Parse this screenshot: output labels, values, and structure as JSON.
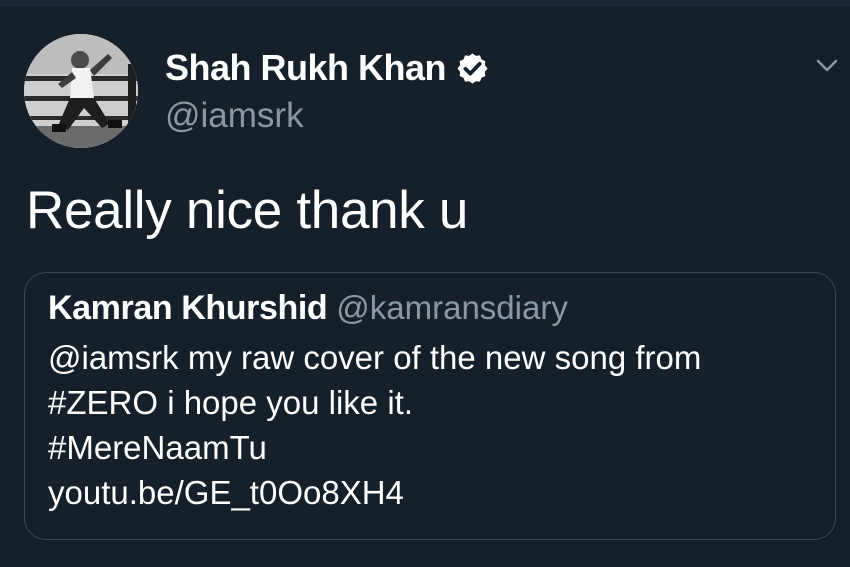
{
  "tweet": {
    "author": {
      "display_name": "Shah Rukh Khan",
      "handle": "@iamsrk",
      "verified": true,
      "avatar_icon": "profile-photo"
    },
    "text": "Really nice thank u",
    "menu_icon": "chevron-down-icon",
    "quoted_tweet": {
      "author_name": "Kamran Khurshid",
      "author_handle": "@kamransdiary",
      "text_lines": [
        "@iamsrk my raw cover of the new song from",
        "#ZERO i hope you like it.",
        "#MereNaamTu",
        "youtu.be/GE_t0Oo8XH4"
      ]
    }
  },
  "colors": {
    "background": "#15202b",
    "secondary_text": "#8899a6",
    "border": "#3d4a58",
    "primary_text": "#ffffff"
  }
}
